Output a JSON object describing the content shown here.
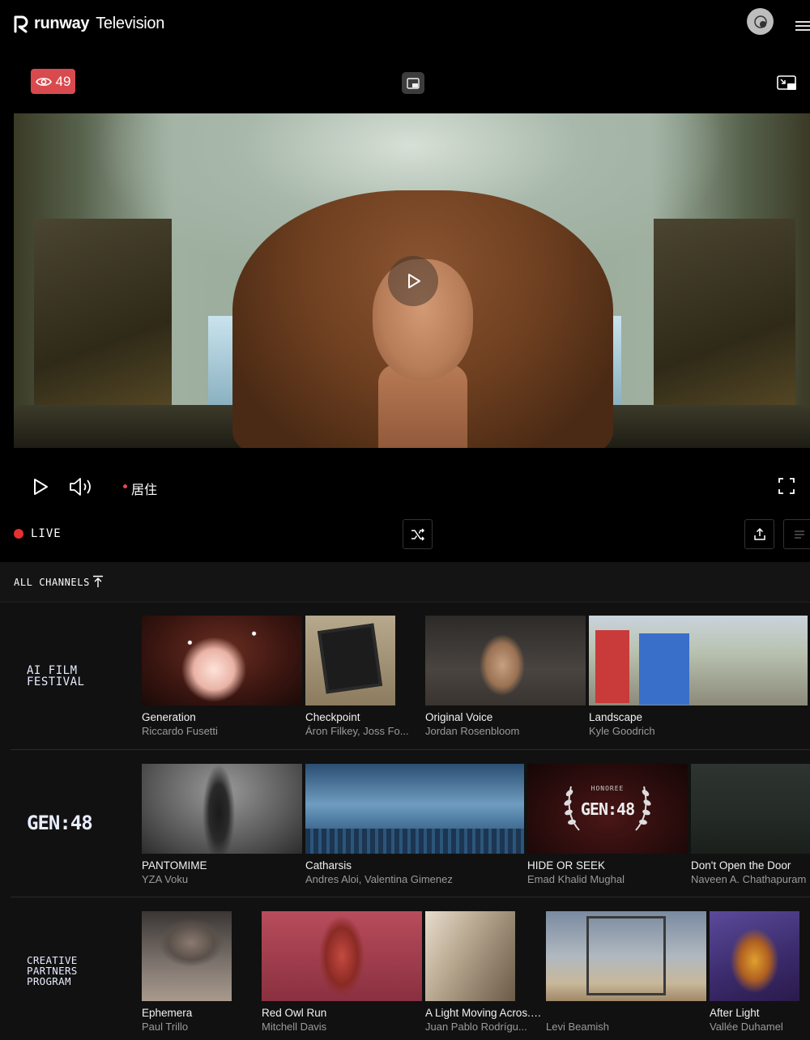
{
  "header": {
    "brand": "runway",
    "brand_sub": "Television"
  },
  "player": {
    "viewer_count": "49",
    "live_label": "居住",
    "status_label": "LIVE"
  },
  "channels": {
    "header_label": "ALL CHANNELS",
    "rows": [
      {
        "brand_lines": [
          "AI FILM",
          "FESTIVAL"
        ],
        "cards": [
          {
            "title": "Generation",
            "subtitle": "Riccardo Fusetti"
          },
          {
            "title": "Checkpoint",
            "subtitle": "Áron Filkey, Joss Fo..."
          },
          {
            "title": "Original Voice",
            "subtitle": "Jordan Rosenbloom"
          },
          {
            "title": "Landscape",
            "subtitle": "Kyle Goodrich"
          }
        ]
      },
      {
        "brand_lines": [
          "GEN:48"
        ],
        "cards": [
          {
            "title": "PANTOMIME",
            "subtitle": "YZA Voku"
          },
          {
            "title": "Catharsis",
            "subtitle": "Andres Aloi, Valentina Gimenez"
          },
          {
            "title": "HIDE OR SEEK",
            "subtitle": "Emad Khalid Mughal",
            "thumb_text": "GEN:48",
            "thumb_badge": "HONOREE"
          },
          {
            "title": "Don't Open the Door",
            "subtitle": "Naveen A. Chathapuram"
          }
        ]
      },
      {
        "brand_lines": [
          "CREATIVE",
          "PARTNERS",
          "PROGRAM"
        ],
        "cards": [
          {
            "title": "Ephemera",
            "subtitle": "Paul Trillo"
          },
          {
            "title": "Red Owl Run",
            "subtitle": "Mitchell Davis"
          },
          {
            "title": "A Light Moving Acros... □",
            "subtitle": "Juan Pablo Rodrígu..."
          },
          {
            "title": "",
            "subtitle": "Levi Beamish"
          },
          {
            "title": "After Light",
            "subtitle": "Vallée Duhamel"
          }
        ]
      }
    ]
  },
  "colors": {
    "accent_red": "#d94a4e",
    "live_red": "#e5312f",
    "panel_bg": "#111111"
  },
  "icons": [
    "runway-logo-icon",
    "avatar-icon",
    "menu-icon",
    "eye-icon",
    "pip-icon",
    "play-icon",
    "volume-icon",
    "fullscreen-icon",
    "shuffle-icon",
    "share-icon",
    "list-icon",
    "arrow-up-icon"
  ]
}
